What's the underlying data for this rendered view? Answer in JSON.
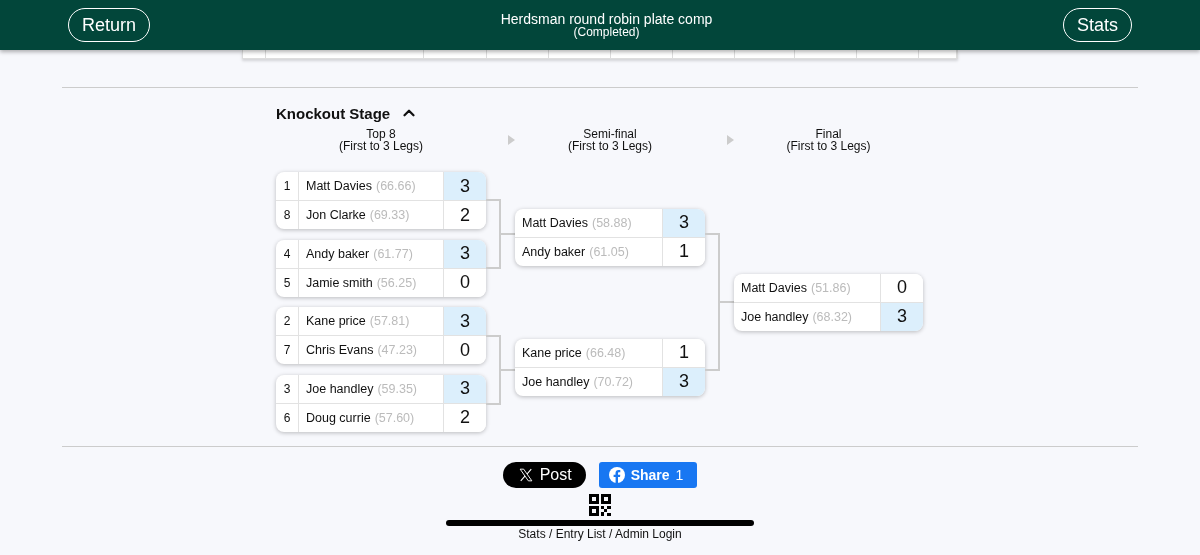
{
  "header": {
    "return_button": "Return",
    "title": "Herdsman round robin plate comp",
    "status": "(Completed)",
    "stats_button": "Stats"
  },
  "knockout": {
    "title": "Knockout Stage",
    "expanded": true,
    "rounds": [
      {
        "name": "Top 8",
        "format": "(First to 3 Legs)",
        "matches": [
          {
            "players": [
              {
                "seed": "1",
                "name": "Matt Davies",
                "average": "(66.66)",
                "score": "3",
                "winner": true
              },
              {
                "seed": "8",
                "name": "Jon Clarke",
                "average": "(69.33)",
                "score": "2",
                "winner": false
              }
            ]
          },
          {
            "players": [
              {
                "seed": "4",
                "name": "Andy baker",
                "average": "(61.77)",
                "score": "3",
                "winner": true
              },
              {
                "seed": "5",
                "name": "Jamie smith",
                "average": "(56.25)",
                "score": "0",
                "winner": false
              }
            ]
          },
          {
            "players": [
              {
                "seed": "2",
                "name": "Kane price",
                "average": "(57.81)",
                "score": "3",
                "winner": true
              },
              {
                "seed": "7",
                "name": "Chris Evans",
                "average": "(47.23)",
                "score": "0",
                "winner": false
              }
            ]
          },
          {
            "players": [
              {
                "seed": "3",
                "name": "Joe handley",
                "average": "(59.35)",
                "score": "3",
                "winner": true
              },
              {
                "seed": "6",
                "name": "Doug currie",
                "average": "(57.60)",
                "score": "2",
                "winner": false
              }
            ]
          }
        ]
      },
      {
        "name": "Semi-final",
        "format": "(First to 3 Legs)",
        "matches": [
          {
            "players": [
              {
                "name": "Matt Davies",
                "average": "(58.88)",
                "score": "3",
                "winner": true
              },
              {
                "name": "Andy baker",
                "average": "(61.05)",
                "score": "1",
                "winner": false
              }
            ]
          },
          {
            "players": [
              {
                "name": "Kane price",
                "average": "(66.48)",
                "score": "1",
                "winner": false
              },
              {
                "name": "Joe handley",
                "average": "(70.72)",
                "score": "3",
                "winner": true
              }
            ]
          }
        ]
      },
      {
        "name": "Final",
        "format": "(First to 3 Legs)",
        "matches": [
          {
            "players": [
              {
                "name": "Matt Davies",
                "average": "(51.86)",
                "score": "0",
                "winner": false
              },
              {
                "name": "Joe handley",
                "average": "(68.32)",
                "score": "3",
                "winner": true
              }
            ]
          }
        ]
      }
    ]
  },
  "share": {
    "post_button": "Post",
    "share_button": "Share",
    "share_count": "1"
  },
  "footer": {
    "links": "Stats / Entry List / Admin Login"
  }
}
